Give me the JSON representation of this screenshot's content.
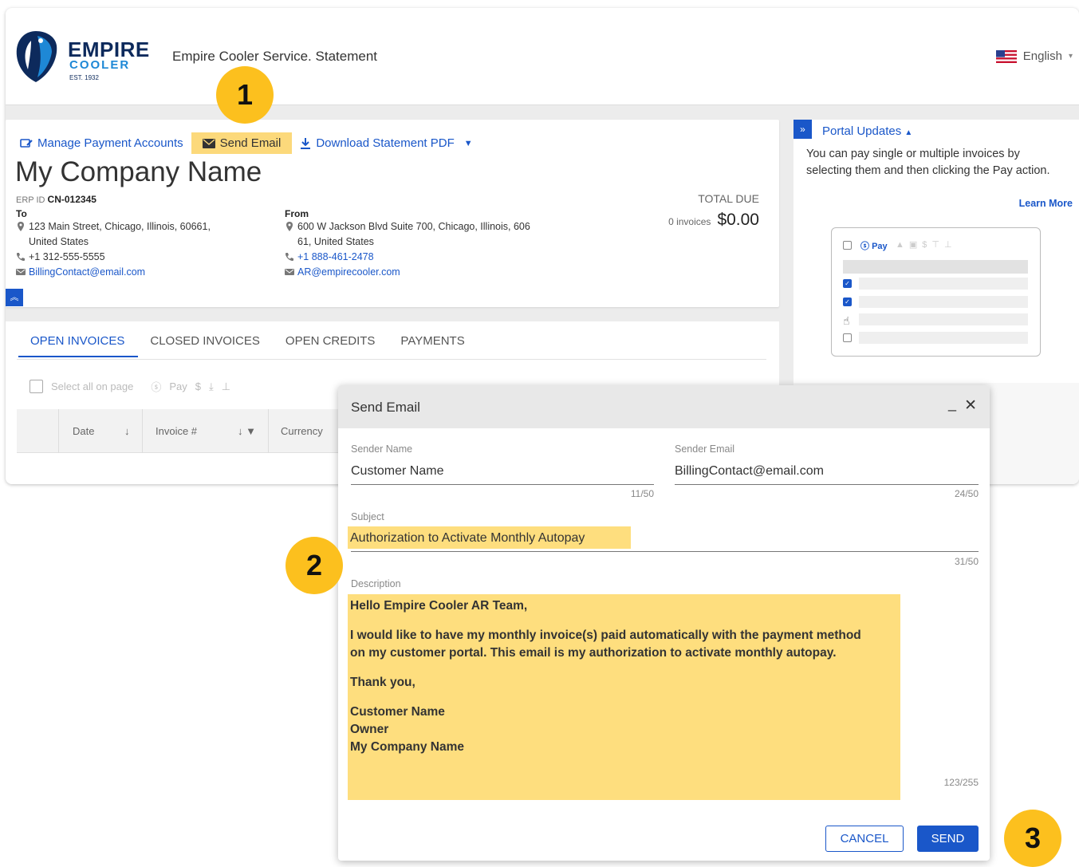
{
  "header": {
    "logo": {
      "line1": "EMPIRE",
      "line2": "COOLER",
      "line3": "EST. 1932"
    },
    "title": "Empire Cooler Service. Statement",
    "language": "English"
  },
  "card": {
    "actions": {
      "manage": "Manage Payment Accounts",
      "send_email": "Send Email",
      "download": "Download Statement PDF"
    },
    "company_name": "My Company Name",
    "erp_label": "ERP ID",
    "erp_value": "CN-012345",
    "to": {
      "label": "To",
      "address_line1": "123 Main Street, Chicago, Illinois, 60661,",
      "address_line2": "United States",
      "phone": "+1 312-555-5555",
      "email": "BillingContact@email.com"
    },
    "from": {
      "label": "From",
      "address_line1": "600 W Jackson Blvd Suite 700, Chicago, Illinois, 606",
      "address_line2": "61, United States",
      "phone": "+1 888-461-2478",
      "email": "AR@empirecooler.com"
    },
    "total_due_label": "TOTAL DUE",
    "invoice_count": "0 invoices",
    "total_amount": "$0.00"
  },
  "tabs": {
    "items": [
      {
        "label": "OPEN INVOICES",
        "active": true
      },
      {
        "label": "CLOSED INVOICES",
        "active": false
      },
      {
        "label": "OPEN CREDITS",
        "active": false
      },
      {
        "label": "PAYMENTS",
        "active": false
      }
    ],
    "select_all": "Select all on page",
    "pay": "Pay",
    "columns": [
      "Date",
      "Invoice #",
      "Currency"
    ]
  },
  "side_panel": {
    "title": "Portal Updates",
    "text": "You can pay single or multiple invoices by selecting them and then clicking the Pay action.",
    "learn_more": "Learn More",
    "mock_pay": "Pay"
  },
  "modal": {
    "title": "Send Email",
    "sender_name_label": "Sender Name",
    "sender_name_value": "Customer Name",
    "sender_name_count": "11/50",
    "sender_email_label": "Sender Email",
    "sender_email_value": "BillingContact@email.com",
    "sender_email_count": "24/50",
    "subject_label": "Subject",
    "subject_value": "Authorization to Activate Monthly Autopay",
    "subject_count": "31/50",
    "description_label": "Description",
    "description": {
      "greeting": "Hello Empire Cooler AR Team,",
      "body_line1": "I would like to have my monthly invoice(s) paid automatically with the payment method",
      "body_line2": "on my customer portal. This email is my authorization to activate monthly autopay.",
      "thanks": "Thank you,",
      "sig_name": "Customer Name",
      "sig_title": "Owner",
      "sig_company": "My Company Name"
    },
    "description_count": "123/255",
    "cancel": "CANCEL",
    "send": "SEND"
  },
  "badges": {
    "one": "1",
    "two": "2",
    "three": "3"
  },
  "colors": {
    "accent": "#1a57c9",
    "highlight": "#fede7e",
    "badge": "#fcc01e",
    "brand_navy": "#0d2a5c"
  }
}
